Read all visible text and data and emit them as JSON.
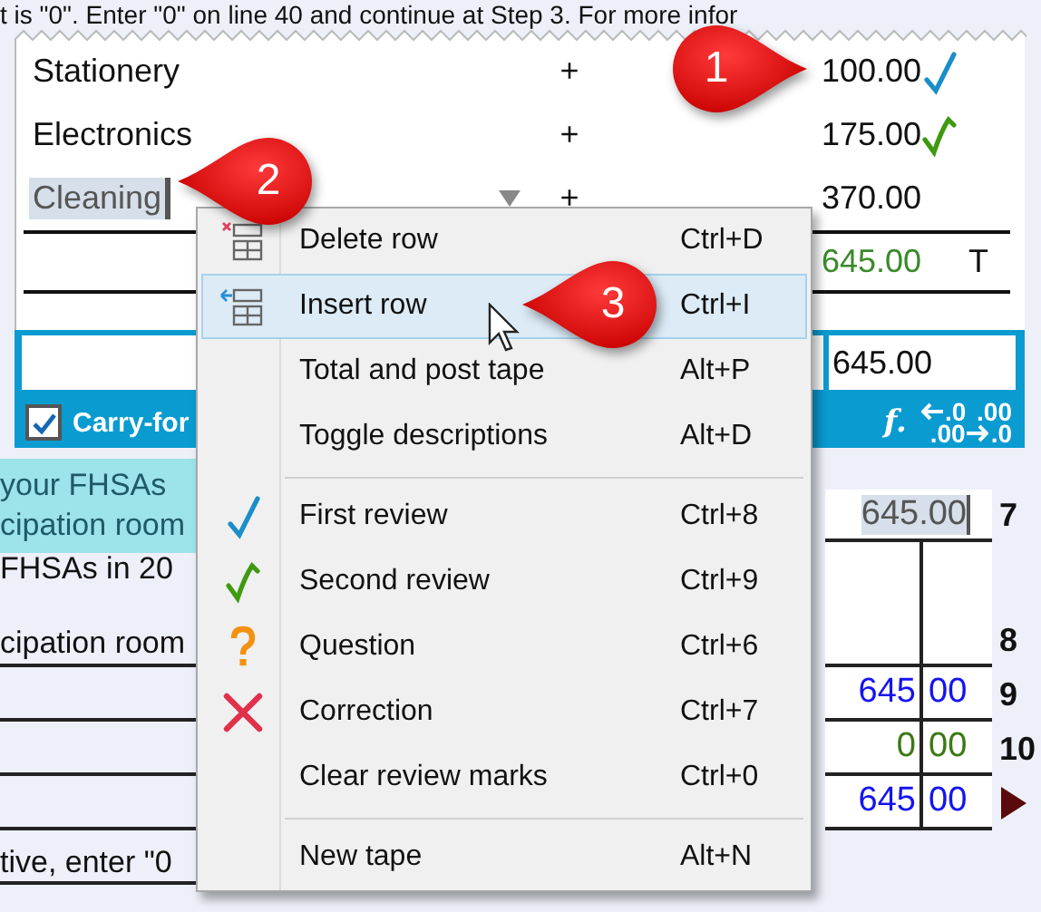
{
  "form": {
    "instruction": "t is \"0\". Enter \"0\" on line 40 and continue at Step 3. For more infor",
    "highlighted_lines": [
      "your FHSAs",
      "cipation room"
    ],
    "fhsa_line": "FHSAs in 20",
    "room_line": "cipation room",
    "negative_line": "tive, enter \"0",
    "line_7": {
      "number": "7",
      "amount": "645.00"
    },
    "line_8": {
      "number": "8"
    },
    "amount_lines": [
      {
        "number": "9",
        "dollars": "645",
        "cents": "00",
        "color": "#1414f0"
      },
      {
        "number": "10",
        "dollars": "0",
        "cents": "00",
        "color": "#3c7a14"
      },
      {
        "dollars": "645",
        "cents": "00",
        "color": "#1414f0"
      }
    ]
  },
  "tape": {
    "rows": [
      {
        "kind": "first-review",
        "description": "Stationery",
        "operator": "+",
        "amount": "100.00",
        "selected": false
      },
      {
        "kind": "second-review",
        "description": "Electronics",
        "operator": "+",
        "amount": "175.00",
        "selected": false
      },
      {
        "kind": "plain",
        "description": "Cleaning",
        "operator": "+",
        "amount": "370.00",
        "selected": true
      }
    ],
    "total": {
      "amount": "645.00",
      "code": "T"
    },
    "result": "645.00",
    "carry_forward": {
      "label": "Carry-for",
      "checked": true
    },
    "function_label": "f.",
    "decimal_tool": {
      "top": [
        ".0",
        ".00"
      ],
      "bottom": [
        ".00",
        ".0"
      ]
    }
  },
  "context_menu": [
    {
      "kind": "delete-row",
      "label": "Delete row",
      "shortcut": "Ctrl+D",
      "selected": false
    },
    {
      "kind": "insert-row",
      "label": "Insert row",
      "shortcut": "Ctrl+I",
      "selected": true
    },
    {
      "kind": "plain",
      "label": "Total and post tape",
      "shortcut": "Alt+P",
      "selected": false
    },
    {
      "kind": "plain",
      "label": "Toggle descriptions",
      "shortcut": "Alt+D",
      "selected": false
    },
    {
      "kind": "separator"
    },
    {
      "kind": "first-review",
      "label": "First review",
      "shortcut": "Ctrl+8",
      "selected": false
    },
    {
      "kind": "second-review",
      "label": "Second review",
      "shortcut": "Ctrl+9",
      "selected": false
    },
    {
      "kind": "question",
      "label": "Question",
      "shortcut": "Ctrl+6",
      "selected": false
    },
    {
      "kind": "correction",
      "label": "Correction",
      "shortcut": "Ctrl+7",
      "selected": false
    },
    {
      "kind": "plain",
      "label": "Clear review marks",
      "shortcut": "Ctrl+0",
      "selected": false
    },
    {
      "kind": "separator"
    },
    {
      "kind": "plain",
      "label": "New tape",
      "shortcut": "Alt+N",
      "selected": false
    }
  ],
  "callouts": [
    {
      "number": "1"
    },
    {
      "number": "2"
    },
    {
      "number": "3"
    }
  ]
}
